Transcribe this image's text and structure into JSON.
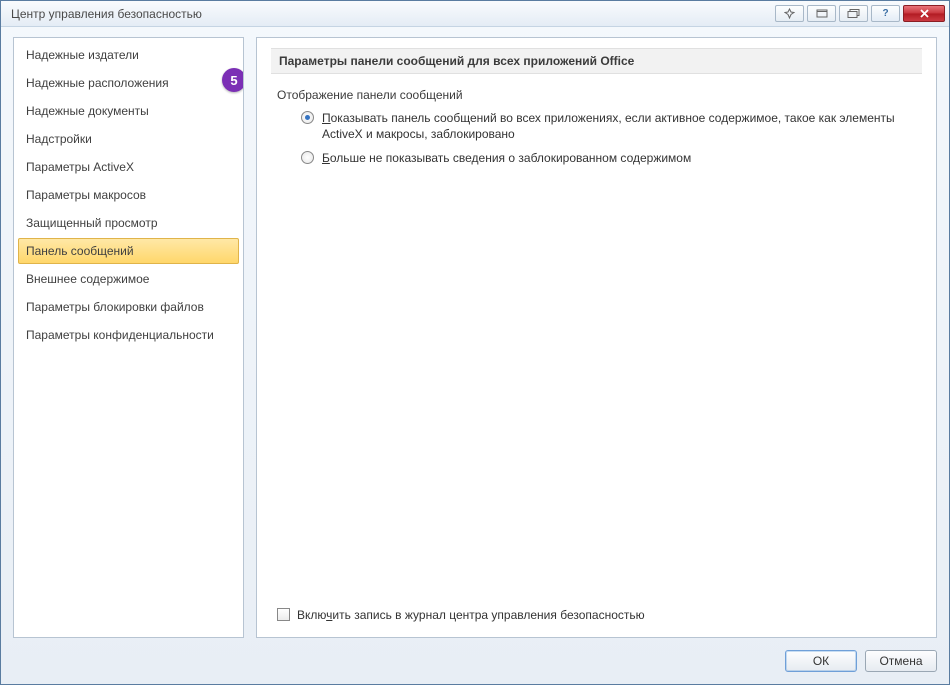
{
  "window": {
    "title": "Центр управления безопасностью"
  },
  "annotation": {
    "step": "5"
  },
  "titlebar": {
    "help_tooltip": "?"
  },
  "sidebar": {
    "items": [
      {
        "label": "Надежные издатели",
        "selected": false
      },
      {
        "label": "Надежные расположения",
        "selected": false
      },
      {
        "label": "Надежные документы",
        "selected": false
      },
      {
        "label": "Надстройки",
        "selected": false
      },
      {
        "label": "Параметры ActiveX",
        "selected": false
      },
      {
        "label": "Параметры макросов",
        "selected": false
      },
      {
        "label": "Защищенный просмотр",
        "selected": false
      },
      {
        "label": "Панель сообщений",
        "selected": true
      },
      {
        "label": "Внешнее содержимое",
        "selected": false
      },
      {
        "label": "Параметры блокировки файлов",
        "selected": false
      },
      {
        "label": "Параметры конфиденциальности",
        "selected": false
      }
    ]
  },
  "content": {
    "section_title": "Параметры панели сообщений для всех приложений Office",
    "group_label": "Отображение панели сообщений",
    "options": [
      {
        "prefix": "П",
        "rest": "оказывать панель сообщений во всех приложениях, если активное содержимое, такое как элементы ActiveX и макросы, заблокировано",
        "checked": true
      },
      {
        "prefix": "Б",
        "rest": "ольше не показывать сведения о заблокированном содержимом",
        "checked": false
      }
    ],
    "log_prefix": "Вклю",
    "log_key": "ч",
    "log_rest": "ить запись в журнал центра управления безопасностью",
    "log_checked": false
  },
  "footer": {
    "ok": "ОК",
    "cancel": "Отмена"
  }
}
